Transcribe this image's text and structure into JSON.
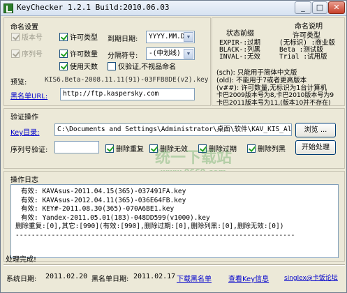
{
  "window": {
    "title": "KeyChecker 1.2.1 Build:2010.06.03",
    "buttons": [
      "_",
      "□",
      "✕"
    ]
  },
  "name_settings": {
    "title": "命名设置",
    "checkboxes": [
      {
        "label": "版本号",
        "checked": true,
        "disabled": true
      },
      {
        "label": "许可类型",
        "checked": true,
        "disabled": false
      },
      {
        "label": "序列号",
        "checked": true,
        "disabled": true
      },
      {
        "label": "许可数量",
        "checked": true,
        "disabled": false
      },
      {
        "label": "使用天数",
        "checked": true,
        "disabled": false
      },
      {
        "label": "仅验证,不视品命名",
        "checked": false,
        "disabled": false
      }
    ],
    "expire_label": "到期日期:",
    "expire_value": "YYYY.MM.DD",
    "sep_label": "分隔符号:",
    "sep_value": "-(中划线)",
    "preview_label": "预览:",
    "preview_value": "KIS6.Beta-2008.11.11(91)-03FFB8DE(v2).key",
    "blacklist_label": "黑名单URL:",
    "blacklist_value": "http://ftp.kaspersky.com"
  },
  "status_prefix": {
    "title": "状态前缀",
    "rows": [
      "EXPIR-:过期",
      "BLACK-:列黑",
      "INVAL-:无效"
    ]
  },
  "naming_desc": {
    "title": "命名说明",
    "license_title": "许可类型",
    "rows": [
      "(无标识) :商业版",
      "Beta :测试版",
      "Trial :试用版"
    ]
  },
  "notes": [
    "(sch): 只能用于简体中文版",
    "(old): 不能用于7或者更高版本",
    "(v##): 许可数量,无标识为1台计算机",
    "卡巴2009版本号为8,卡巴2010版本号为9",
    "卡巴2011版本号为11,(版本10并不存在)"
  ],
  "verify": {
    "title": "验证操作",
    "key_dir_label": "Key目录:",
    "key_dir_value": "C:\\Documents and Settings\\Administrator\\桌面\\软件\\KAV_KIS_AllVerKey\\",
    "browse_button": "浏览 ...",
    "serial_label": "序列号验证:",
    "serial_value": "",
    "options": [
      {
        "label": "删除重复",
        "checked": true
      },
      {
        "label": "删除无效",
        "checked": true
      },
      {
        "label": "删除过期",
        "checked": true
      },
      {
        "label": "删除列黑",
        "checked": true
      }
    ],
    "start_button": "开始处理"
  },
  "log": {
    "title": "操作日志",
    "lines": [
      "有效: KAVAsus-2011.04.15(365)-037491FA.key",
      "有效: KAVAsus-2012.04.11(365)-036E64FB.key",
      "有效: KEY#-2011.08.30(365)-070A6BE1.key",
      "有效: Yandex-2011.05.01(183)-048DD599(v1000).key",
      "删除重复:[0],其它:[990](有效:[990],删除过期:[0],删除列黑:[0],删除无效:[0])",
      "----------------------------------------------------------------------"
    ]
  },
  "status_bar": {
    "message": "处理完成!",
    "system_date_label": "系统日期:",
    "system_date": "2011.02.20",
    "blacklist_date_label": "黑名单日期:",
    "blacklist_date": "2011.02.17",
    "download_link": "下载黑名单",
    "view_key_link": "查看Key信息",
    "author_link": "singlex@卡饭论坛"
  },
  "watermark": {
    "main": "统一下载站",
    "sub": "www.9669.com"
  }
}
